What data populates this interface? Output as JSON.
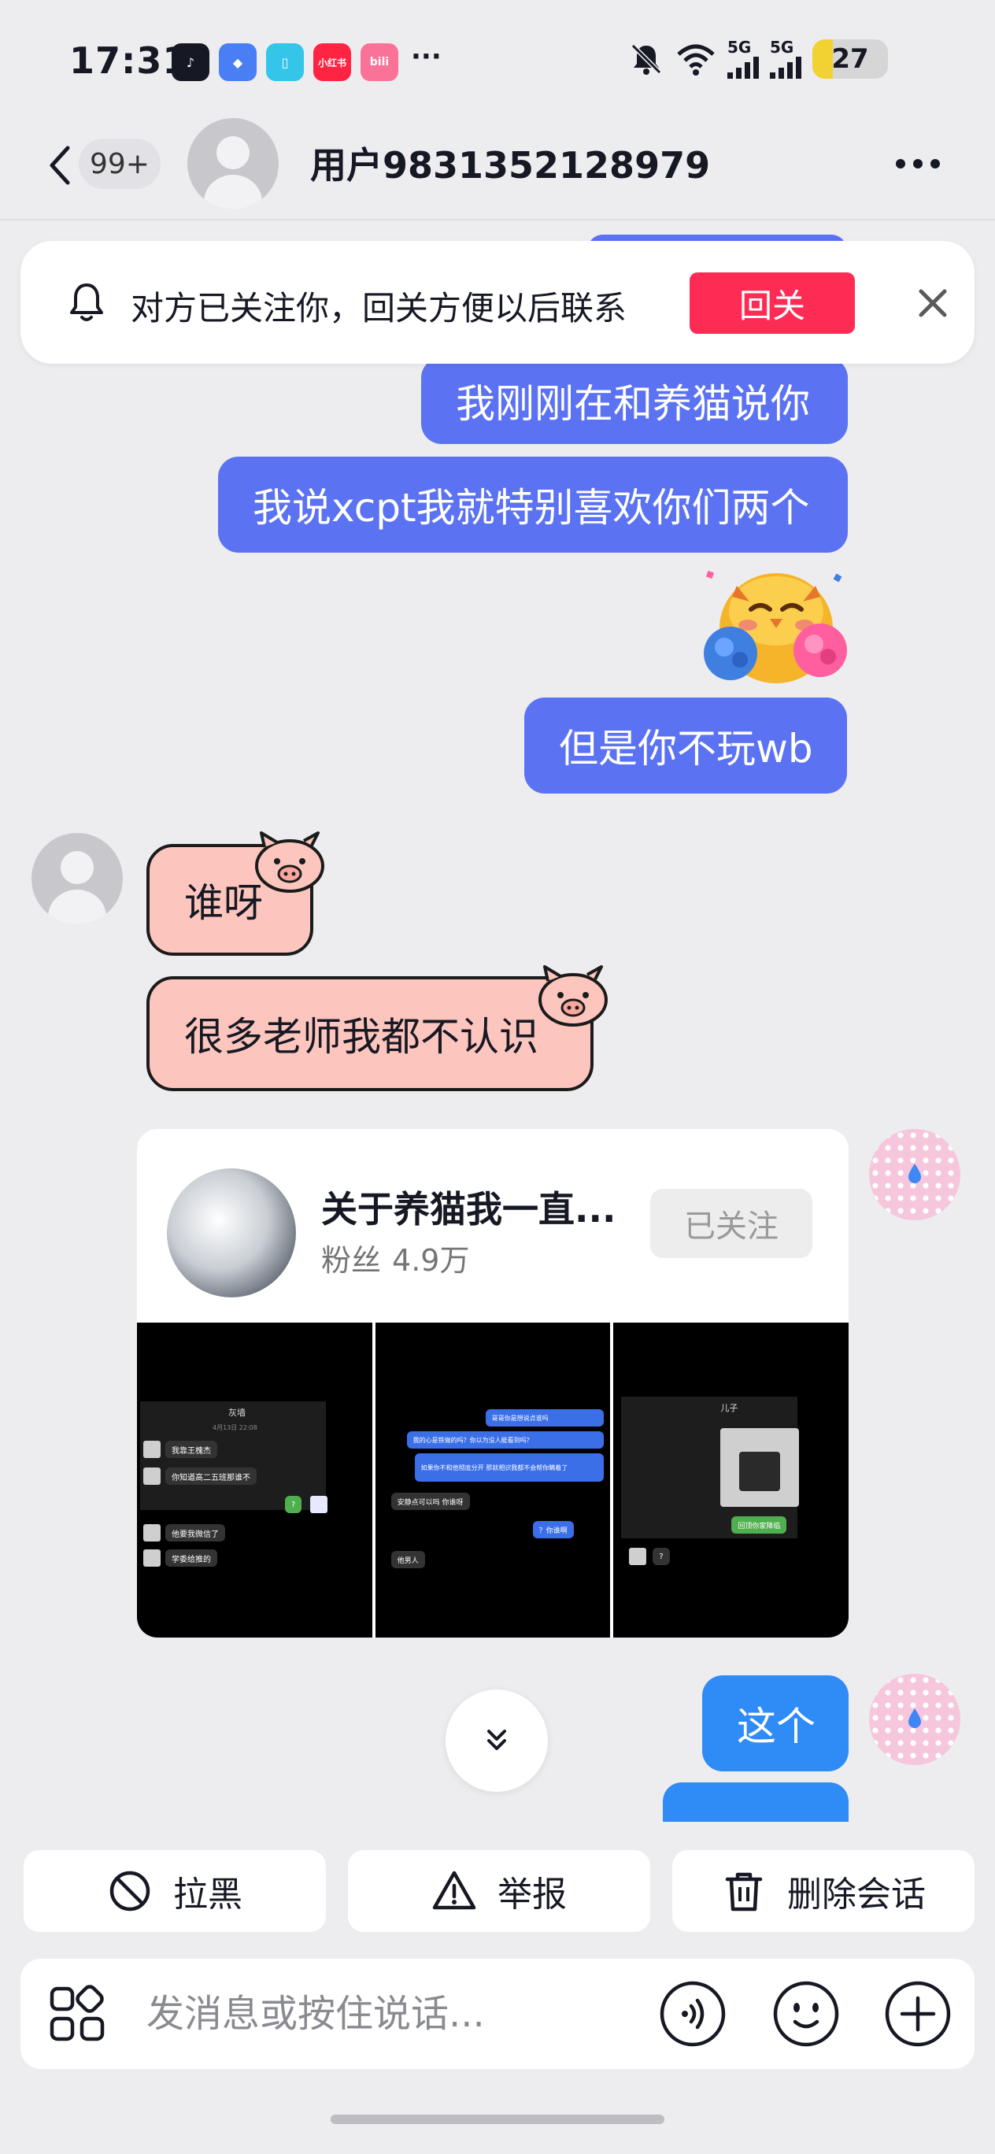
{
  "status_bar": {
    "time": "17:31",
    "app_icons": [
      {
        "name": "tiktok-icon",
        "label": "♪",
        "color": "#161823"
      },
      {
        "name": "app-blue-icon",
        "label": "◆",
        "color": "#4a7ef5"
      },
      {
        "name": "reader-app-icon",
        "label": "▯",
        "color": "#34c5e8"
      },
      {
        "name": "xiaohongshu-icon",
        "label": "小红书",
        "color": "#ff2442"
      },
      {
        "name": "bilibili-icon",
        "label": "bili",
        "color": "#fb7299"
      }
    ],
    "more_dots": "···",
    "signal_1_label": "5G",
    "signal_2_label": "5G",
    "battery_level": "27"
  },
  "header": {
    "unread_count": "99+",
    "username": "用户9831352128979"
  },
  "banner": {
    "text": "对方已关注你，回关方便以后联系",
    "follow_back_label": "回关"
  },
  "messages": {
    "sent_1": "我刚刚在和养猫说你",
    "sent_2": "我说xcpt我就特别喜欢你们两个",
    "sent_3": "但是你不玩wb",
    "received_1": "谁呀",
    "received_2": "很多老师我都不认识",
    "sent_4": "这个"
  },
  "share_card": {
    "title": "关于养猫我一直...",
    "fans_label": "粉丝",
    "fans_count": "4.9万",
    "follow_status": "已关注",
    "thumb_1": {
      "title": "灰墙",
      "date": "4月13日 22:08",
      "lines": [
        "我靠王槐杰",
        "你知道高二五班那谁不",
        "他要我微信了",
        "学委给推的"
      ],
      "reply": "?"
    },
    "thumb_2": {
      "lines": [
        "哥哥你是想说点谁吗",
        "我的心是铁做的吗？你以为没人能看到吗？",
        "如果你不和他彻底分开 那就相识我都不会帮你瞒着了"
      ],
      "left_1": "安静点可以吗 你谁呀",
      "right": "？你谁啊",
      "left_2": "他男人"
    },
    "thumb_3": {
      "title": "儿子",
      "reply_green": "回顶你家降临",
      "reply": "?"
    }
  },
  "actions": {
    "block": "拉黑",
    "report": "举报",
    "delete": "删除会话"
  },
  "input": {
    "placeholder": "发消息或按住说话..."
  },
  "colors": {
    "sent_bubble": "#5b72f2",
    "sent_bubble_recent": "#2f8bf5",
    "received_bubble": "#fcc5bd",
    "follow_button": "#fe2c55",
    "background": "#ededf0"
  }
}
